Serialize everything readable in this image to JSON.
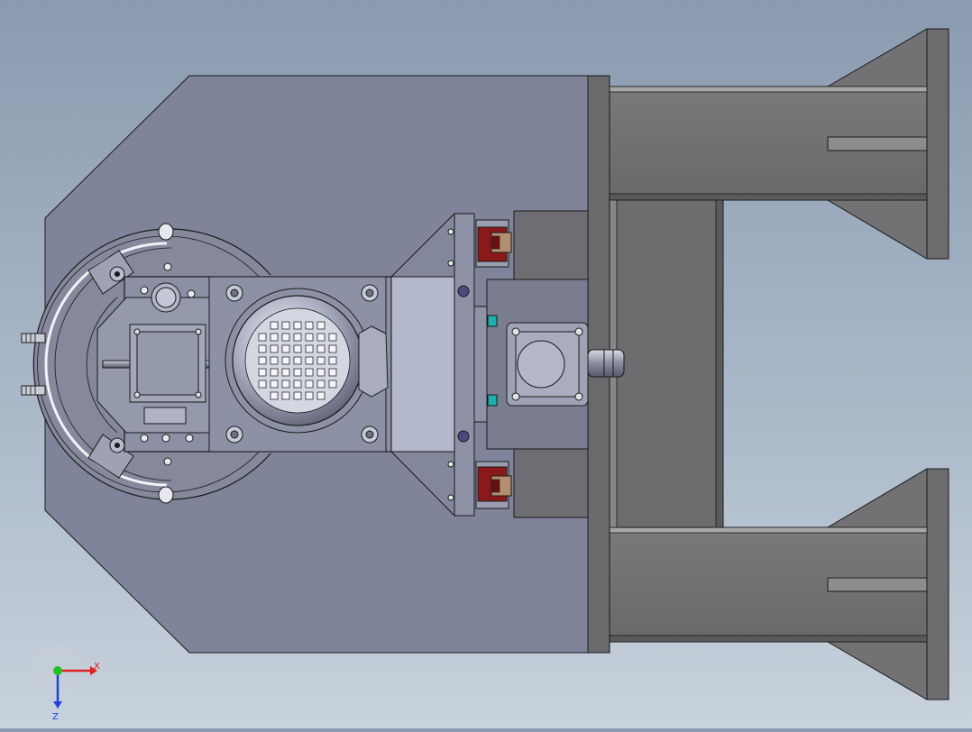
{
  "viewport": {
    "background_top": "#8a9bb0",
    "background_bottom": "#c8d2dc",
    "body_color": "#80849a",
    "steel_color": "#6e6e70",
    "edge_color": "#1a1a1a",
    "motor_color": "#b8bccc",
    "red_block_color": "#8a1a1a",
    "cyan_marker_color": "#1ab0b0"
  },
  "triad": {
    "x_label": "X",
    "z_label": "Z",
    "x_color": "#e02020",
    "y_color": "#20c020",
    "z_color": "#2040e0"
  }
}
